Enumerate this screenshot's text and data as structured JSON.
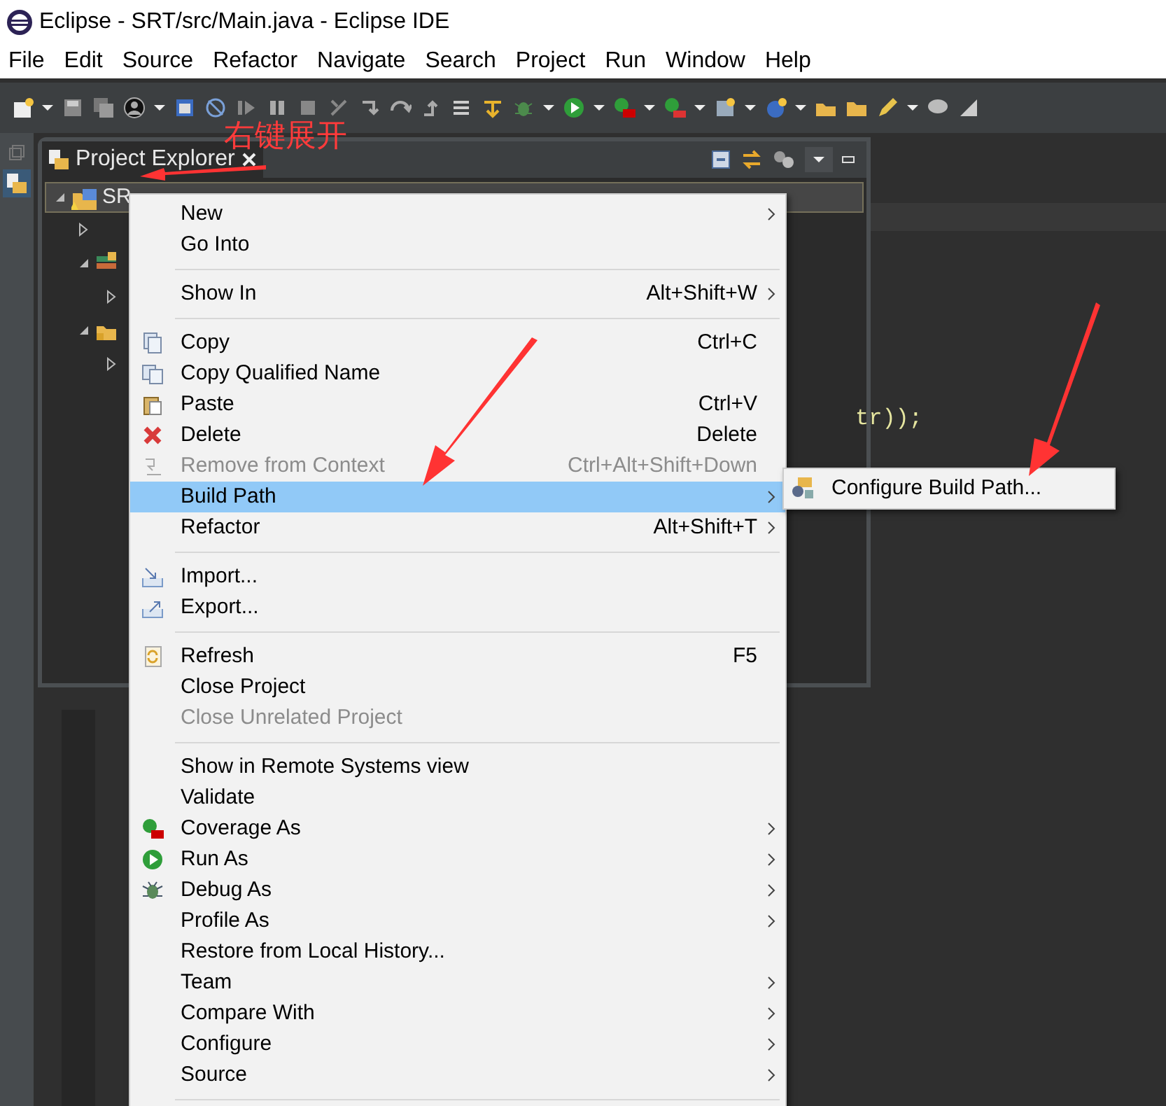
{
  "window": {
    "title": "Eclipse - SRT/src/Main.java - Eclipse IDE"
  },
  "menu_bar": [
    "File",
    "Edit",
    "Source",
    "Refactor",
    "Navigate",
    "Search",
    "Project",
    "Run",
    "Window",
    "Help"
  ],
  "project_explorer": {
    "tab": {
      "label": "Project Explorer",
      "selected": true
    },
    "tree": [
      {
        "label": "SR",
        "expanded": true,
        "selected": true,
        "children": [
          {
            "expanded": false
          },
          {
            "expanded": true,
            "children": [
              {
                "expanded": false
              }
            ]
          },
          {
            "expanded": true,
            "children": [
              {
                "expanded": false
              }
            ]
          }
        ]
      }
    ]
  },
  "editor": {
    "code_fragment": "tr));"
  },
  "annotation": {
    "text": "右键展开"
  },
  "context_menu": [
    {
      "kind": "item",
      "label": "New",
      "submenu": true,
      "disabled": false,
      "selected": false
    },
    {
      "kind": "item",
      "label": "Go Into",
      "submenu": false,
      "disabled": false,
      "selected": false
    },
    {
      "kind": "separator"
    },
    {
      "kind": "item",
      "label": "Show In",
      "shortcut": "Alt+Shift+W",
      "submenu": true,
      "disabled": false,
      "selected": false
    },
    {
      "kind": "separator"
    },
    {
      "kind": "item",
      "label": "Copy",
      "shortcut": "Ctrl+C",
      "submenu": false,
      "disabled": false,
      "selected": false
    },
    {
      "kind": "item",
      "label": "Copy Qualified Name",
      "submenu": false,
      "disabled": false,
      "selected": false
    },
    {
      "kind": "item",
      "label": "Paste",
      "shortcut": "Ctrl+V",
      "submenu": false,
      "disabled": false,
      "selected": false
    },
    {
      "kind": "item",
      "label": "Delete",
      "shortcut": "Delete",
      "submenu": false,
      "disabled": false,
      "selected": false
    },
    {
      "kind": "item",
      "label": "Remove from Context",
      "shortcut": "Ctrl+Alt+Shift+Down",
      "submenu": false,
      "disabled": true,
      "selected": false
    },
    {
      "kind": "item",
      "label": "Build Path",
      "submenu": true,
      "disabled": false,
      "selected": true
    },
    {
      "kind": "item",
      "label": "Refactor",
      "shortcut": "Alt+Shift+T",
      "submenu": true,
      "disabled": false,
      "selected": false
    },
    {
      "kind": "separator"
    },
    {
      "kind": "item",
      "label": "Import...",
      "submenu": false,
      "disabled": false,
      "selected": false
    },
    {
      "kind": "item",
      "label": "Export...",
      "submenu": false,
      "disabled": false,
      "selected": false
    },
    {
      "kind": "separator"
    },
    {
      "kind": "item",
      "label": "Refresh",
      "shortcut": "F5",
      "submenu": false,
      "disabled": false,
      "selected": false
    },
    {
      "kind": "item",
      "label": "Close Project",
      "submenu": false,
      "disabled": false,
      "selected": false
    },
    {
      "kind": "item",
      "label": "Close Unrelated Project",
      "submenu": false,
      "disabled": true,
      "selected": false
    },
    {
      "kind": "separator"
    },
    {
      "kind": "item",
      "label": "Show in Remote Systems view",
      "submenu": false,
      "disabled": false,
      "selected": false
    },
    {
      "kind": "item",
      "label": "Validate",
      "submenu": false,
      "disabled": false,
      "selected": false
    },
    {
      "kind": "item",
      "label": "Coverage As",
      "submenu": true,
      "disabled": false,
      "selected": false
    },
    {
      "kind": "item",
      "label": "Run As",
      "submenu": true,
      "disabled": false,
      "selected": false
    },
    {
      "kind": "item",
      "label": "Debug As",
      "submenu": true,
      "disabled": false,
      "selected": false
    },
    {
      "kind": "item",
      "label": "Profile As",
      "submenu": true,
      "disabled": false,
      "selected": false
    },
    {
      "kind": "item",
      "label": "Restore from Local History...",
      "submenu": false,
      "disabled": false,
      "selected": false
    },
    {
      "kind": "item",
      "label": "Team",
      "submenu": true,
      "disabled": false,
      "selected": false
    },
    {
      "kind": "item",
      "label": "Compare With",
      "submenu": true,
      "disabled": false,
      "selected": false
    },
    {
      "kind": "item",
      "label": "Configure",
      "submenu": true,
      "disabled": false,
      "selected": false
    },
    {
      "kind": "item",
      "label": "Source",
      "submenu": true,
      "disabled": false,
      "selected": false
    },
    {
      "kind": "separator"
    }
  ],
  "submenu": [
    {
      "label": "Configure Build Path..."
    }
  ]
}
